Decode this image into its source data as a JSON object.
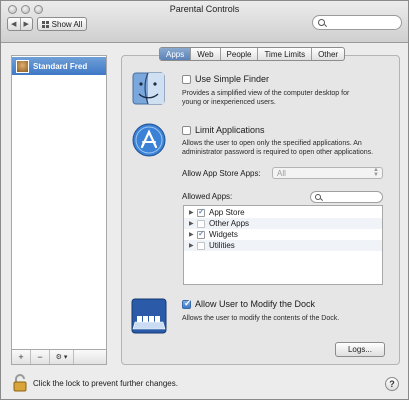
{
  "window": {
    "title": "Parental Controls",
    "show_all_label": "Show All",
    "back_icon": "chevron-left-icon",
    "forward_icon": "chevron-right-icon"
  },
  "sidebar": {
    "users": [
      {
        "name": "Standard Fred",
        "selected": true
      }
    ],
    "bottom_buttons": [
      "+",
      "−",
      "⚙ ▾"
    ]
  },
  "tabs": [
    "Apps",
    "Web",
    "People",
    "Time Limits",
    "Other"
  ],
  "active_tab": "Apps",
  "simple_finder": {
    "label": "Use Simple Finder",
    "checked": false,
    "description_line1": "Provides a simplified view of the computer desktop for",
    "description_line2": "young or inexperienced users."
  },
  "limit_apps": {
    "label": "Limit Applications",
    "checked": false,
    "description_line1": "Allows the user to open only the specified applications. An",
    "description_line2": "administrator password is required to open other applications.",
    "app_store_label": "Allow App Store Apps:",
    "app_store_value": "All",
    "allowed_apps_label": "Allowed Apps:",
    "apps": [
      {
        "name": "App Store",
        "checked": true
      },
      {
        "name": "Other Apps",
        "checked": false
      },
      {
        "name": "Widgets",
        "checked": true
      },
      {
        "name": "Utilities",
        "checked": false
      }
    ]
  },
  "dock": {
    "label": "Allow User to Modify the Dock",
    "checked": true,
    "description": "Allows the user to modify the contents of the Dock."
  },
  "logs_button": "Logs...",
  "lock_text": "Click the lock to prevent further changes.",
  "help_label": "?",
  "colors": {
    "accent": "#3f78c6",
    "window_bg": "#ececec"
  }
}
